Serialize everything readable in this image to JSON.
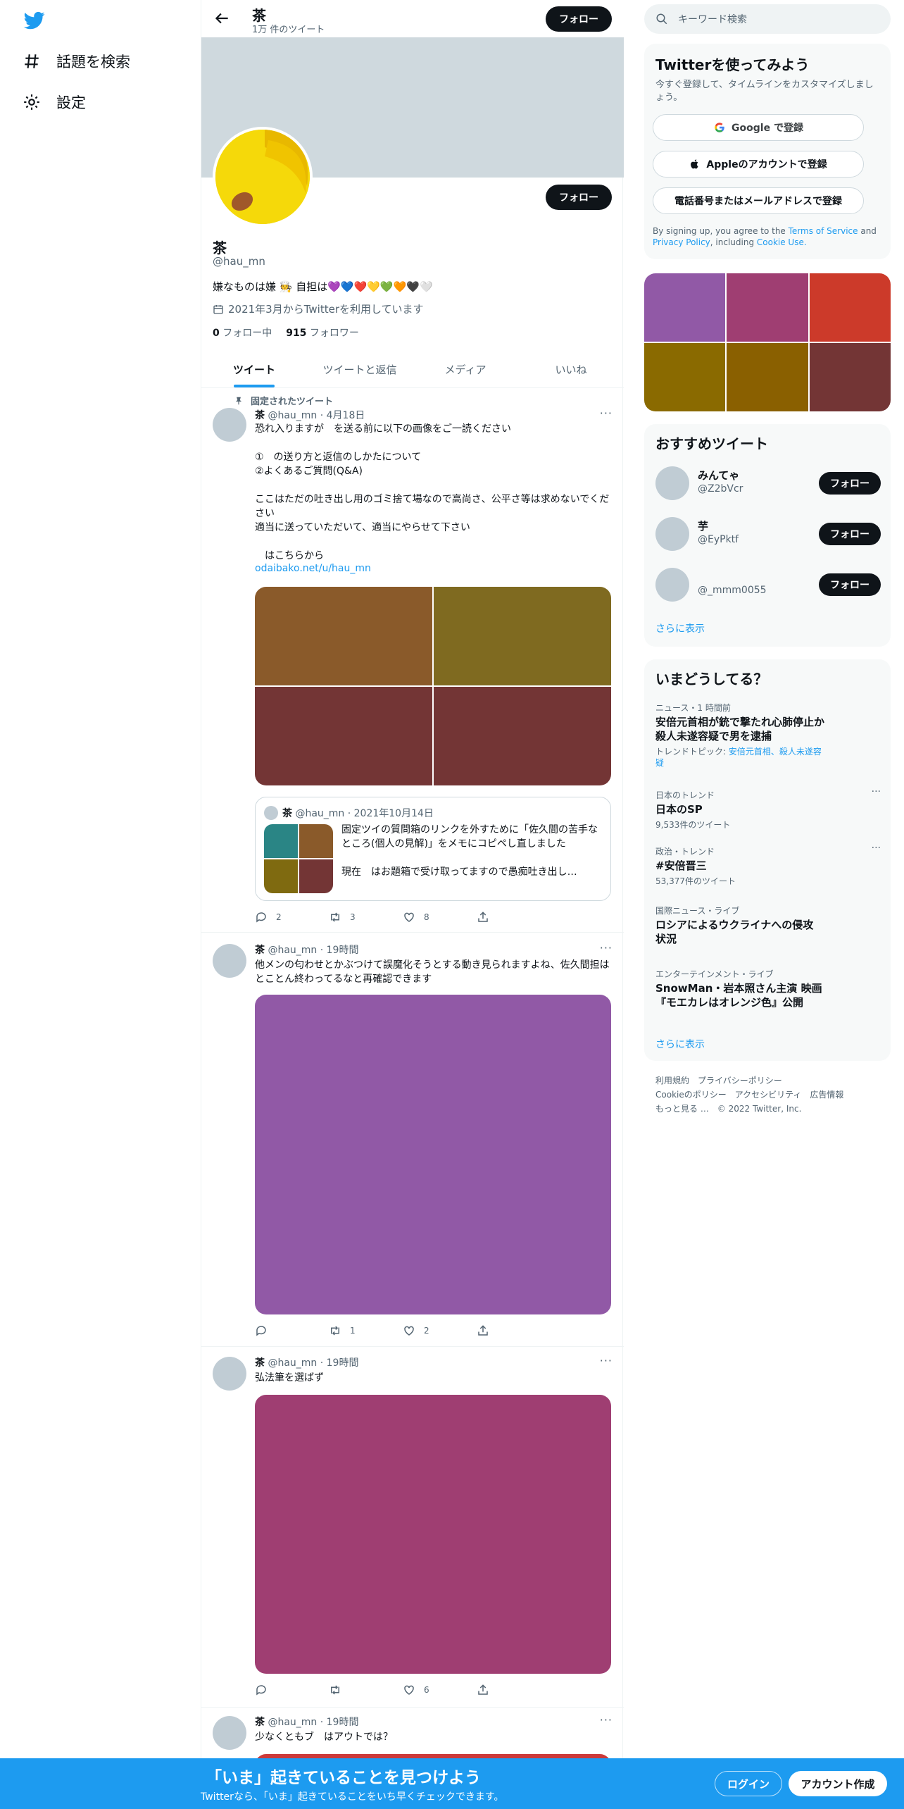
{
  "nav": {
    "items": [
      {
        "label": "話題を検索",
        "icon": "hashtag-icon"
      },
      {
        "label": "設定",
        "icon": "gear-icon"
      }
    ]
  },
  "header": {
    "title": "茶",
    "subtitle": "1万 件のツイート",
    "follow_label": "フォロー"
  },
  "profile": {
    "name": "茶",
    "handle": "@hau_mn",
    "bio": "嫌なものは嫌 🧑‍🍳 自担は💜💙❤️💛💚🧡🖤🤍",
    "joined": "2021年3月からTwitterを利用しています",
    "following_count": "0",
    "following_label": "フォロー中",
    "followers_count": "915",
    "followers_label": "フォロワー",
    "follow_label": "フォロー"
  },
  "tabs": [
    "ツイート",
    "ツイートと返信",
    "メディア",
    "いいね"
  ],
  "pinned_label": "固定されたツイート",
  "tweets": [
    {
      "name": "茶",
      "meta": "@hau_mn · 4月18日",
      "text": "恐れ入りますが　を送る前に以下の画像をご一読ください\n\n①　の送り方と返信のしかたについて\n②よくあるご質問(Q&A)\n\nここはただの吐き出し用のゴミ捨て場なので高尚さ、公平さ等は求めないでください\n適当に送っていただいて、適当にやらせて下さい\n\n　はこちらから",
      "link": "odaibako.net/u/hau_mn",
      "media_colors": [
        "#8a5a2a",
        "#7f6a20",
        "#733535",
        "#733535"
      ],
      "quote": {
        "name": "茶",
        "meta": "@hau_mn · 2021年10月14日",
        "text": "固定ツイの質問箱のリンクを外すために「佐久間の苦手なところ(個人の見解)」をメモにコピペし直しました\n\n現在　はお題箱で受け取ってますので愚痴吐き出し…",
        "thumb_colors": [
          "#2a8585",
          "#8a5a2a",
          "#7f6a10",
          "#733535"
        ]
      },
      "replies": "2",
      "retweets": "3",
      "likes": "8"
    },
    {
      "name": "茶",
      "meta": "@hau_mn · 19時間",
      "text": "他メンの匂わせとかぶつけて誤魔化そうとする動き見られますよね、佐久間担はとことん終わってるなと再確認できます",
      "media_color": "#9159a6",
      "replies": "",
      "retweets": "1",
      "likes": "2"
    },
    {
      "name": "茶",
      "meta": "@hau_mn · 19時間",
      "text": "弘法筆を選ばず",
      "media_color": "#9f3e72",
      "replies": "",
      "retweets": "",
      "likes": "6"
    },
    {
      "name": "茶",
      "meta": "@hau_mn · 19時間",
      "text": "少なくともブ　はアウトでは？",
      "media_color": "#cc3a3a"
    }
  ],
  "search": {
    "placeholder": "キーワード検索"
  },
  "signup": {
    "title": "Twitterを使ってみよう",
    "subtitle": "今すぐ登録して、タイムラインをカスタマイズしましょう。",
    "google": "Google で登録",
    "apple": "Appleのアカウントで登録",
    "phone": "電話番号またはメールアドレスで登録",
    "legal_prefix": "By signing up, you agree to the ",
    "terms": "Terms of Service",
    "and": " and ",
    "privacy": "Privacy Policy",
    "including": ", including ",
    "cookie": "Cookie Use."
  },
  "media_grid": [
    "#9159a6",
    "#9f3e72",
    "#cc3a2a",
    "#8a6a00",
    "#8a6000",
    "#733535"
  ],
  "recommend": {
    "title": "おすすめツイート",
    "users": [
      {
        "name": "みんてゃ",
        "handle": "@Z2bVcr"
      },
      {
        "name": "芋",
        "handle": "@EyPktf"
      },
      {
        "name": "",
        "handle": "@_mmm0055"
      }
    ],
    "follow_label": "フォロー",
    "more": "さらに表示"
  },
  "trends": {
    "title": "いまどうしてる？",
    "items": [
      {
        "category": "ニュース・1 時間前",
        "title": "安倍元首相が銃で撃たれ心肺停止か 殺人未遂容疑で男を逮捕",
        "extra_prefix": "トレンドトピック: ",
        "extra_link": "安倍元首相、殺人未遂容疑"
      },
      {
        "category": "日本のトレンド",
        "title": "日本のSP",
        "extra": "9,533件のツイート"
      },
      {
        "category": "政治・トレンド",
        "title": "#安倍晋三",
        "extra": "53,377件のツイート"
      },
      {
        "category": "国際ニュース・ライブ",
        "title": "ロシアによるウクライナへの侵攻状況"
      },
      {
        "category": "エンターテインメント・ライブ",
        "title": "SnowMan・岩本照さん主演 映画『モエカレはオレンジ色』公開"
      }
    ],
    "more": "さらに表示"
  },
  "footer": {
    "line1": "利用規約　プライバシーポリシー",
    "line2": "Cookieのポリシー　アクセシビリティ　広告情報",
    "line3": "もっと見る …　© 2022 Twitter, Inc."
  },
  "bottombar": {
    "title": "「いま」起きていることを見つけよう",
    "subtitle": "Twitterなら、「いま」起きていることをいち早くチェックできます。",
    "login": "ログイン",
    "signup": "アカウント作成"
  },
  "colors": {
    "accent": "#1d9bf0",
    "dark": "#0f1419",
    "muted": "#536471",
    "banner": "#cfd9de"
  }
}
